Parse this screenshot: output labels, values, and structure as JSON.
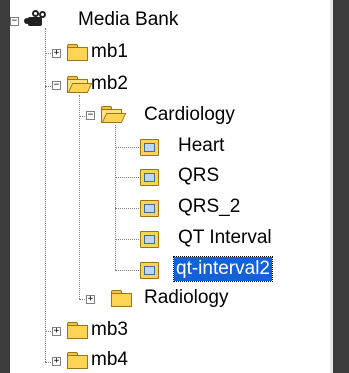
{
  "tree": {
    "root": {
      "label": "Media Bank",
      "icon": "video-camera-icon",
      "expanded": true
    },
    "nodes": [
      {
        "key": "mb1",
        "label": "mb1",
        "expanded": false
      },
      {
        "key": "mb2",
        "label": "mb2",
        "expanded": true
      },
      {
        "key": "cardiology",
        "label": "Cardiology",
        "expanded": true
      },
      {
        "key": "heart",
        "label": "Heart"
      },
      {
        "key": "qrs",
        "label": "QRS"
      },
      {
        "key": "qrs2",
        "label": "QRS_2"
      },
      {
        "key": "qtinterval",
        "label": "QT Interval"
      },
      {
        "key": "qtinterval2",
        "label": "qt-interval2",
        "selected": true
      },
      {
        "key": "radiology",
        "label": "Radiology",
        "expanded": false
      },
      {
        "key": "mb3",
        "label": "mb3",
        "expanded": false
      },
      {
        "key": "mb4",
        "label": "mb4",
        "expanded": false
      }
    ],
    "expand_glyph": "+",
    "collapse_glyph": "−"
  },
  "colors": {
    "selection": "#1460d6",
    "folder": "#ffd454",
    "frame": "#3c3c3c"
  }
}
